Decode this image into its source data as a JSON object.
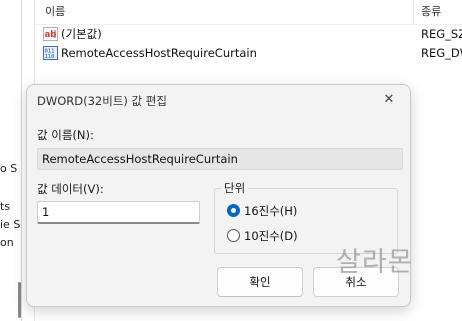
{
  "left_fragments": [
    "o S",
    "ts",
    "ie S",
    "on"
  ],
  "list": {
    "columns": {
      "name": "이름",
      "type": "종류"
    },
    "rows": [
      {
        "icon": "string-value-icon",
        "name": "(기본값)",
        "type": "REG_SZ"
      },
      {
        "icon": "dword-value-icon",
        "name": "RemoteAccessHostRequireCurtain",
        "type": "REG_DW"
      }
    ]
  },
  "dialog": {
    "title": "DWORD(32비트) 값 편집",
    "close_glyph": "✕",
    "value_name_label": "값 이름(N):",
    "value_name": "RemoteAccessHostRequireCurtain",
    "value_data_label": "값 데이터(V):",
    "value_data": "1",
    "base_label": "단위",
    "base_options": [
      {
        "label": "16진수(H)",
        "selected": true
      },
      {
        "label": "10진수(D)",
        "selected": false
      }
    ],
    "ok_label": "확인",
    "cancel_label": "취소"
  },
  "watermark": "살라몬",
  "colors": {
    "accent": "#0067c0",
    "dialog_bg": "#f3f3f3",
    "readonly_field": "#e6e6e6"
  }
}
